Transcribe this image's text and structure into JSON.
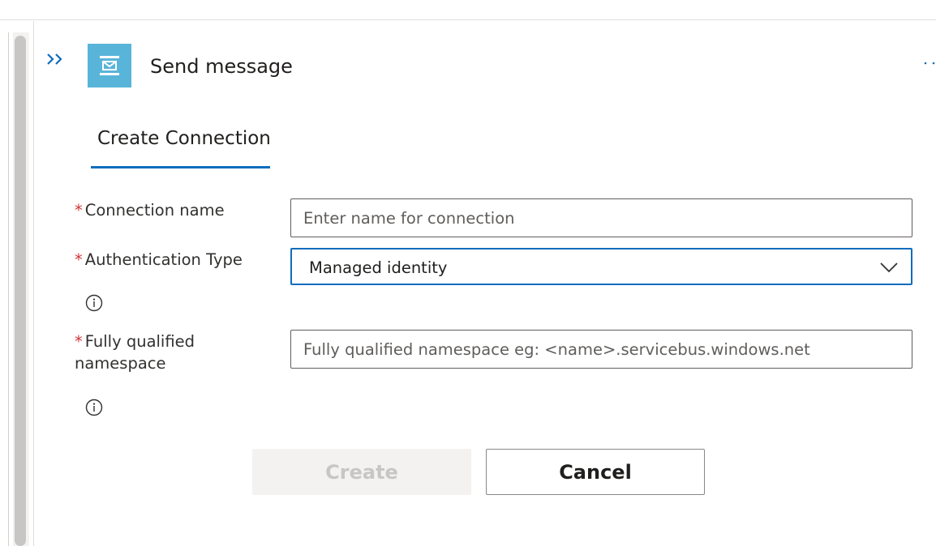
{
  "header": {
    "title": "Send message",
    "collapse_icon": "double-chevron-right-icon",
    "app_icon": "service-bus-message-icon",
    "more_icon": "more-options-icon"
  },
  "tabs": [
    {
      "label": "Create Connection",
      "active": true
    }
  ],
  "form": {
    "required_marker": "*",
    "connection_name": {
      "label": "Connection name",
      "placeholder": "Enter name for connection",
      "value": ""
    },
    "authentication_type": {
      "label": "Authentication Type",
      "value": "Managed identity",
      "info_icon": "info-icon"
    },
    "namespace": {
      "label": "Fully qualified namespace",
      "placeholder": "Fully qualified namespace eg: <name>.servicebus.windows.net",
      "value": "",
      "info_icon": "info-icon"
    }
  },
  "actions": {
    "create_label": "Create",
    "create_disabled": true,
    "cancel_label": "Cancel"
  },
  "colors": {
    "accent": "#0f6cbd",
    "app_icon_bg": "#59b4d9",
    "required": "#d13438",
    "disabled_bg": "#f3f2f1",
    "disabled_text": "#c8c6c4"
  }
}
